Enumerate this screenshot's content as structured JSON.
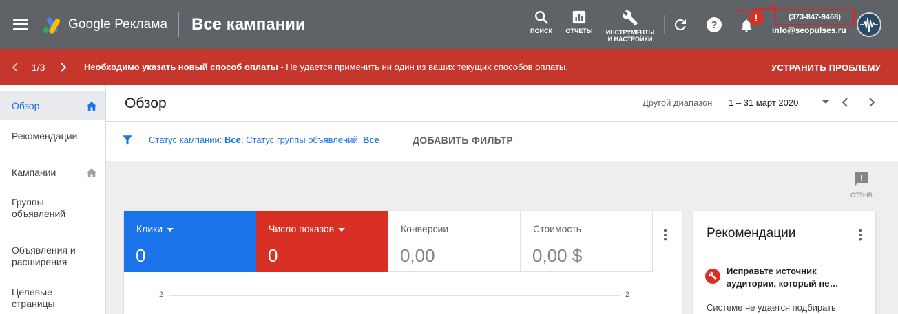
{
  "topbar": {
    "brand": "Google Реклама",
    "page_title": "Все кампании",
    "tools": [
      {
        "label": "ПОИСК",
        "icon": "search-icon"
      },
      {
        "label": "ОТЧЕТЫ",
        "icon": "reports-icon"
      },
      {
        "label_line1": "ИНСТРУМЕНТЫ",
        "label_line2": "И НАСТРОЙКИ",
        "icon": "wrench-icon"
      }
    ],
    "notification_badge": "!",
    "phone": "(373-847-9468)",
    "email": "info@seopulses.ru",
    "colors": {
      "bar": "#5f6368",
      "highlight": "#ea1d25"
    }
  },
  "alert": {
    "pager": "1/3",
    "title": "Необходимо указать новый способ оплаты",
    "message": " - Не удается применить ни один из ваших текущих способов оплаты.",
    "action": "УСТРАНИТЬ ПРОБЛЕМУ",
    "color": "#c5372c"
  },
  "sidebar": {
    "items": [
      {
        "label": "Обзор",
        "active": true
      },
      {
        "label": "Рекомендации"
      },
      {
        "label": "Кампании"
      },
      {
        "label_line1": "Группы",
        "label_line2": "объявлений"
      },
      {
        "label_line1": "Объявления и",
        "label_line2": "расширения"
      },
      {
        "label_line1": "Целевые",
        "label_line2": "страницы"
      }
    ]
  },
  "main": {
    "title": "Обзор",
    "range_label": "Другой диапазон",
    "range_value": "1 – 31 март 2020",
    "filter": {
      "campaign_label": "Статус кампании: ",
      "campaign_value": "Все",
      "group_label": "; Статус группы объявлений: ",
      "group_value": "Все",
      "add_filter": "ДОБАВИТЬ ФИЛЬТР"
    },
    "feedback_label": "ОТЗЫВ"
  },
  "metrics": {
    "tiles": [
      {
        "label": "Клики",
        "value": "0",
        "color": "#1a73e8"
      },
      {
        "label": "Число показов",
        "value": "0",
        "color": "#d93025"
      },
      {
        "label": "Конверсии",
        "value": "0,00"
      },
      {
        "label": "Стоимость",
        "value": "0,00 $"
      }
    ],
    "axis_left": "2",
    "axis_right": "2"
  },
  "recommendations": {
    "title": "Рекомендации",
    "item_title": "Исправьте источник аудитории, который не…",
    "item_body": "Системе не удается подбирать"
  }
}
